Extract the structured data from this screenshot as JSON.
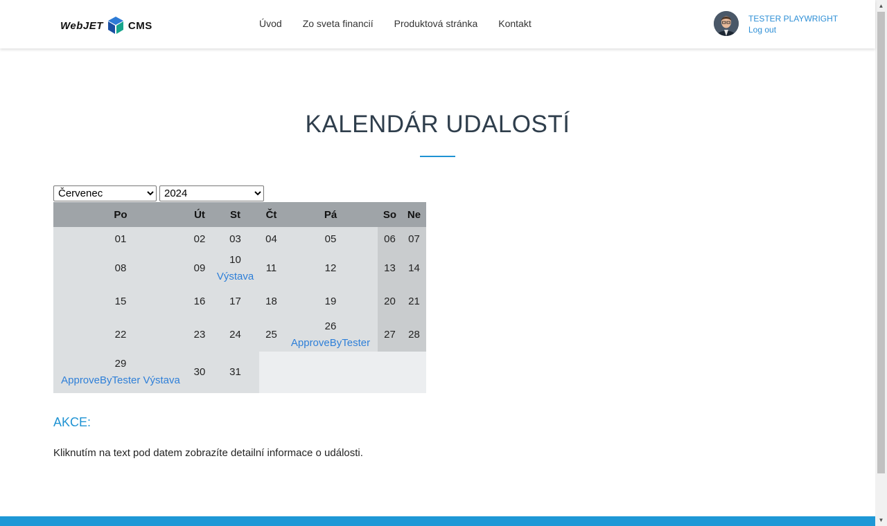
{
  "header": {
    "logo_left": "WebJET",
    "logo_right": "CMS",
    "nav": [
      "Úvod",
      "Zo sveta financií",
      "Produktová stránka",
      "Kontakt"
    ],
    "user_name": "TESTER PLAYWRIGHT",
    "logout": "Log out"
  },
  "page": {
    "title": "KALENDÁR UDALOSTÍ"
  },
  "filters": {
    "month": "Červenec",
    "year": "2024"
  },
  "calendar": {
    "days": [
      "Po",
      "Út",
      "St",
      "Čt",
      "Pá",
      "So",
      "Ne"
    ],
    "weeks": [
      [
        "01",
        "02",
        "03",
        "04",
        "05",
        "06",
        "07"
      ],
      [
        "08",
        "09",
        "10",
        "11",
        "12",
        "13",
        "14"
      ],
      [
        "15",
        "16",
        "17",
        "18",
        "19",
        "20",
        "21"
      ],
      [
        "22",
        "23",
        "24",
        "25",
        "26",
        "27",
        "28"
      ],
      [
        "29",
        "30",
        "31",
        "",
        "",
        "",
        ""
      ]
    ],
    "events": {
      "d10": "Výstava",
      "d26": "ApproveByTester",
      "d29": "ApproveByTester Výstava"
    }
  },
  "akce": {
    "heading": "AKCE:",
    "hint": "Kliknutím na text pod datem zobrazíte detailní informace o události."
  },
  "colors": {
    "accent": "#1f93d3",
    "link": "#2e7fd8",
    "header_bg": "#9fa4a8",
    "weekday_bg": "#dcdfe1",
    "weekend_bg": "#c9ccce",
    "footer": "#1e98d6"
  }
}
